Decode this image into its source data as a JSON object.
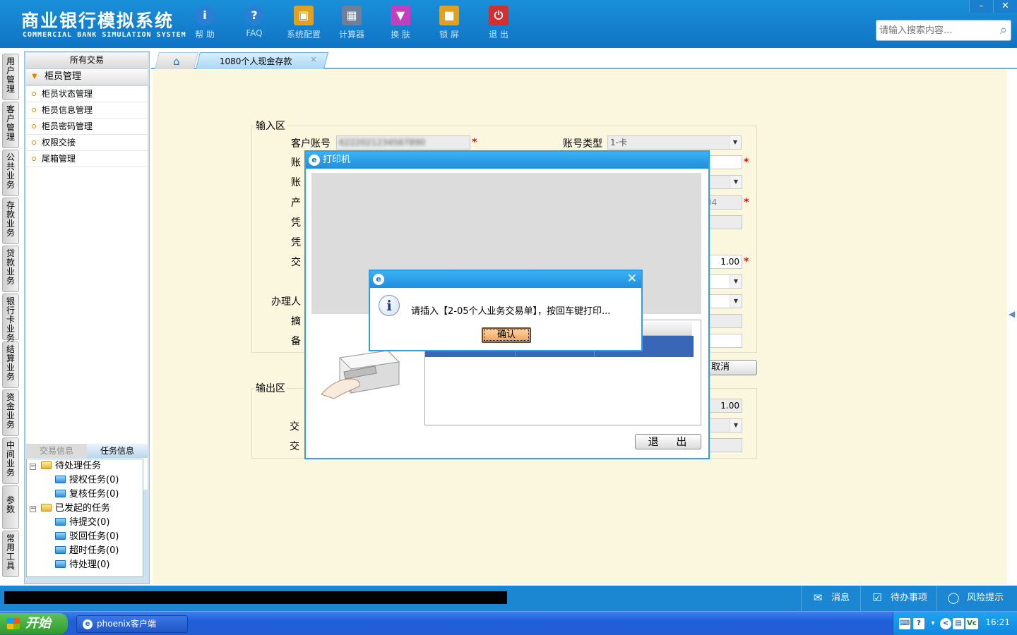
{
  "header": {
    "logo_cn": "商业银行模拟系统",
    "logo_en": "COMMERCIAL BANK SIMULATION SYSTEM",
    "tools": [
      {
        "label": "帮 助",
        "icon": "info-icon",
        "color": "#2a7fd4"
      },
      {
        "label": "FAQ",
        "icon": "question-icon",
        "color": "#2a7fd4"
      },
      {
        "label": "系统配置",
        "icon": "toolbox-icon",
        "color": "#e0a020"
      },
      {
        "label": "计算器",
        "icon": "calculator-icon",
        "color": "#6f7f99"
      },
      {
        "label": "换 肤",
        "icon": "shirt-icon",
        "color": "#c040c0"
      },
      {
        "label": "锁 屏",
        "icon": "lock-icon",
        "color": "#e0a020"
      },
      {
        "label": "退 出",
        "icon": "power-icon",
        "color": "#d03030"
      }
    ],
    "search_placeholder": "请输入搜索内容..."
  },
  "vnav": [
    "用户管理",
    "客户管理",
    "公共业务",
    "存款业务",
    "贷款业务",
    "银行卡业务",
    "结算业务",
    "资金业务",
    "中间业务",
    "参数",
    "常用工具"
  ],
  "sidebar": {
    "title": "所有交易",
    "group": "柜员管理",
    "items": [
      "柜员状态管理",
      "柜员信息管理",
      "柜员密码管理",
      "权限交接",
      "尾箱管理"
    ],
    "tab_tx": "交易信息",
    "tab_task": "任务信息",
    "tree": {
      "pending": "待处理任务",
      "pending_children": [
        "授权任务(0)",
        "复核任务(0)"
      ],
      "started": "已发起的任务",
      "started_children": [
        "待提交(0)",
        "驳回任务(0)",
        "超时任务(0)",
        "待处理(0)"
      ]
    }
  },
  "tabs": {
    "current": "1080个人现金存款"
  },
  "form": {
    "input_legend": "输入区",
    "output_legend": "输出区",
    "customer_account_label": "客户账号",
    "customer_account_value": "6222021234567890",
    "account_type_label": "账号类型",
    "account_type_value": "1-卡",
    "frag_labels": [
      "账",
      "账",
      "产",
      "凭",
      "凭",
      "交",
      "办理人",
      "摘",
      "备"
    ],
    "product_value_frag": "04",
    "amount_value": "1.00",
    "cancel_label": "取消",
    "out_frag_labels": [
      "交",
      "交"
    ],
    "out_amount_value": "1.00"
  },
  "printer": {
    "title": "打印机",
    "exit_label": "退 出"
  },
  "msgbox": {
    "message": "请插入【2-05个人业务交易单】，按回车键打印...",
    "ok_label": "确认"
  },
  "statusbar": {
    "message_label": "消息",
    "todo_label": "待办事项",
    "risk_label": "风险提示"
  },
  "taskbar": {
    "start_label": "开始",
    "app_label": "phoenix客户端",
    "clock": "16:21"
  }
}
